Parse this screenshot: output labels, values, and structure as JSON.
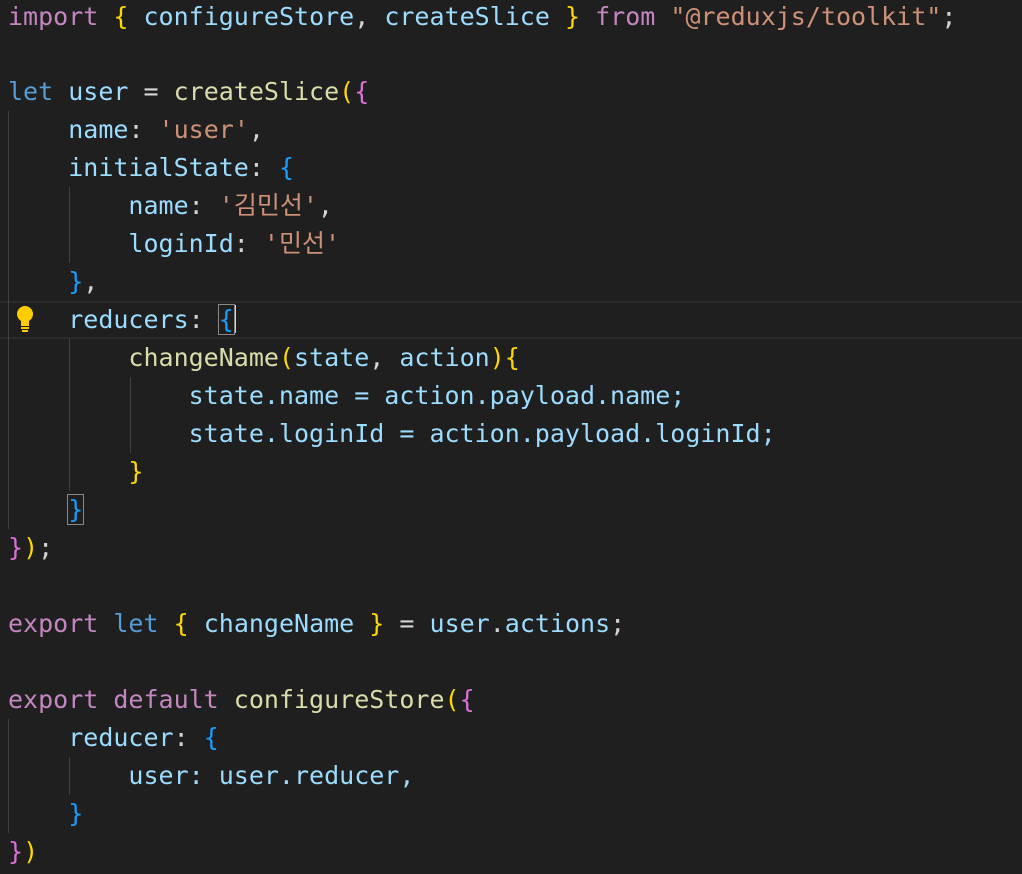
{
  "editor": {
    "module": "@reduxjs/toolkit",
    "store_fn": "configureStore",
    "slice_fn": "createSlice",
    "slice_var": "user",
    "slice_name": "user",
    "state_keys": [
      "name",
      "loginId"
    ],
    "state_name_value": "김민선",
    "state_login_value": "민선",
    "reducer_fn": "changeName",
    "reducer_params": [
      "state",
      "action"
    ],
    "reducer_lines": [
      "state.name = action.payload.name;",
      "state.loginId = action.payload.loginId;"
    ],
    "exported_action": "changeName",
    "store_reducer_entry": "user: user.reducer,",
    "active_line_icon": "lightbulb-icon"
  }
}
